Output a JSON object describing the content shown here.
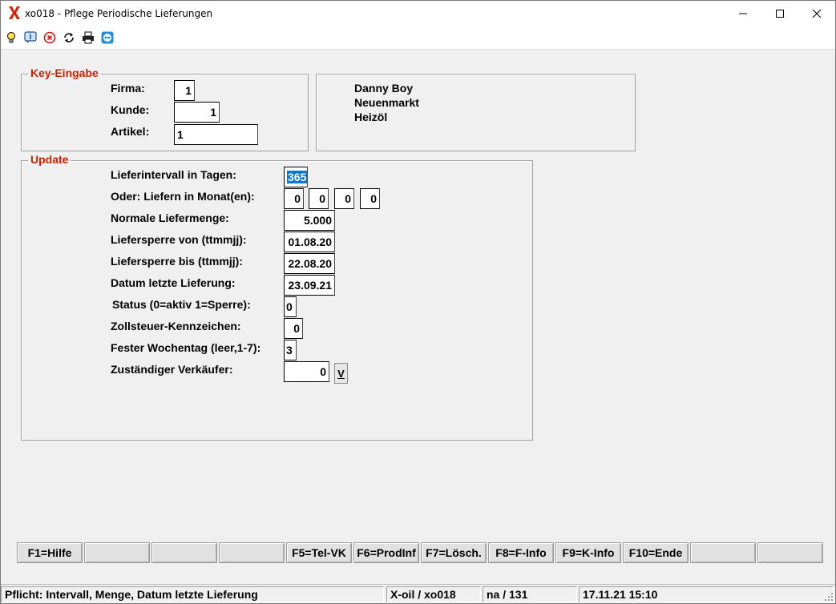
{
  "window": {
    "title": "xo018 - Pflege Periodische Lieferungen"
  },
  "toolbar": {
    "icons": [
      "lightbulb-icon",
      "info-icon",
      "close-circle-icon",
      "refresh-icon",
      "printer-icon",
      "teamviewer-icon"
    ]
  },
  "key_group": {
    "legend": "Key-Eingabe",
    "firma_label": "Firma:",
    "firma_value": "1",
    "kunde_label": "Kunde:",
    "kunde_value": "1",
    "artikel_label": "Artikel:",
    "artikel_value": "1"
  },
  "info_panel": {
    "line1": "Danny Boy",
    "line2": "Neuenmarkt",
    "line3": "Heizöl"
  },
  "update_group": {
    "legend": "Update",
    "interval_label": "Lieferintervall in Tagen:",
    "interval_value": "365",
    "months_label": "Oder: Liefern in Monat(en):",
    "month1": "0",
    "month2": "0",
    "month3": "0",
    "month4": "0",
    "menge_label": "Normale Liefermenge:",
    "menge_value": "5.000",
    "sperre_von_label": "Liefersperre von (ttmmjj):",
    "sperre_von_value": "01.08.20",
    "sperre_bis_label": "Liefersperre bis (ttmmjj):",
    "sperre_bis_value": "22.08.20",
    "letzte_label": "Datum letzte Lieferung:",
    "letzte_value": "23.09.21",
    "status_label": "Status (0=aktiv 1=Sperre):",
    "status_value": "0",
    "zoll_label": "Zollsteuer-Kennzeichen:",
    "zoll_value": "0",
    "wochentag_label": "Fester Wochentag (leer,1-7):",
    "wochentag_value": "3",
    "verkaeufer_label": "Zuständiger Verkäufer:",
    "verkaeufer_value": "0",
    "verkaeufer_button": "V"
  },
  "fkeys": [
    "F1=Hilfe",
    "",
    "",
    "",
    "F5=Tel-VK",
    "F6=ProdInf",
    "F7=Lösch.",
    "F8=F-Info",
    "F9=K-Info",
    "F10=Ende",
    "",
    ""
  ],
  "statusbar": {
    "message": "Pflicht: Intervall, Menge, Datum letzte Lieferung",
    "program": "X-oil / xo018",
    "user": "na / 131",
    "datetime": "17.11.21 15:10"
  }
}
